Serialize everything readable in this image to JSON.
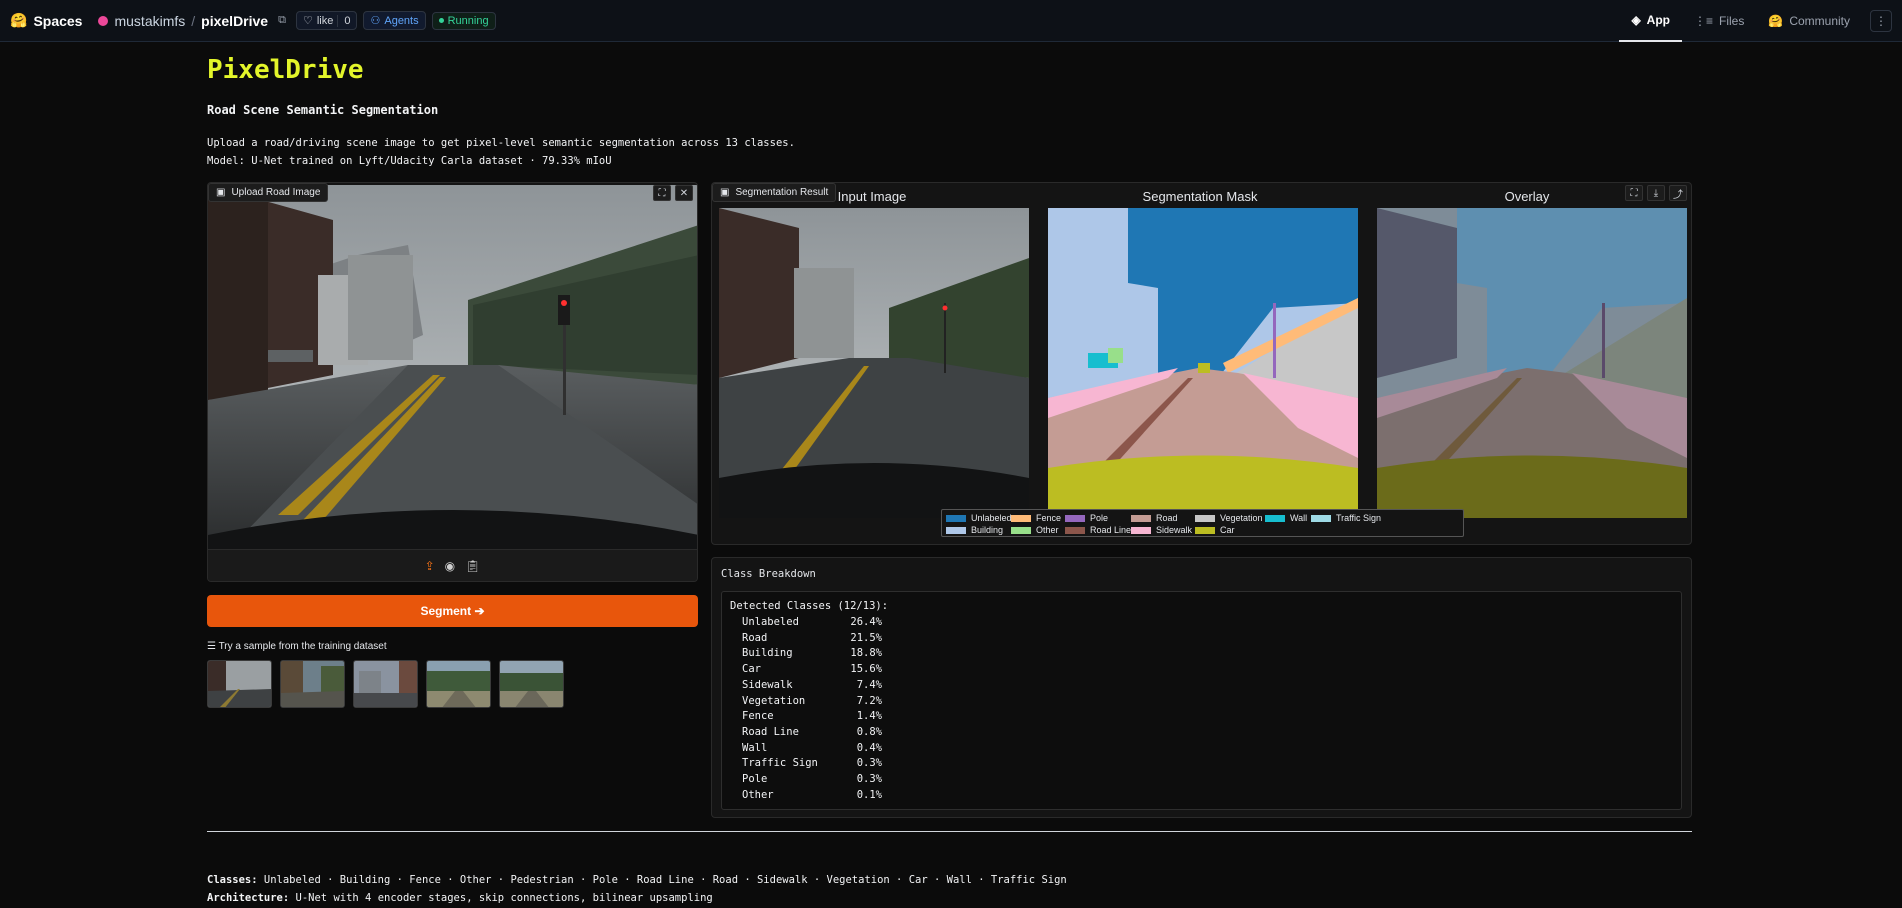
{
  "topbar": {
    "spaces_label": "Spaces",
    "owner": "mustakimfs",
    "separator": "/",
    "repo": "pixelDrive",
    "like_label": "like",
    "like_count": "0",
    "agents_label": "Agents",
    "status_label": "Running",
    "nav": [
      {
        "label": "App",
        "icon": "cube-icon",
        "active": true
      },
      {
        "label": "Files",
        "icon": "files-icon",
        "active": false
      },
      {
        "label": "Community",
        "icon": "community-icon",
        "active": false
      }
    ]
  },
  "header": {
    "title": "PixelDrive",
    "subtitle": "Road Scene Semantic Segmentation",
    "desc_line1": "Upload a road/driving scene image to get pixel-level semantic segmentation across 13 classes.",
    "desc_line2": "Model: U-Net trained on Lyft/Udacity Carla dataset · 79.33% mIoU"
  },
  "upload": {
    "label": "Upload Road Image",
    "button_label": "Segment ➔",
    "samples_label": "☰ Try a sample from the training dataset"
  },
  "result": {
    "label": "Segmentation Result",
    "col_input": "Input Image",
    "col_mask": "Segmentation Mask",
    "col_overlay": "Overlay",
    "legend": [
      {
        "name": "Unlabeled",
        "color": "#1f77b4"
      },
      {
        "name": "Building",
        "color": "#aec7e8"
      },
      {
        "name": "Fence",
        "color": "#ffbb78"
      },
      {
        "name": "Other",
        "color": "#98df8a"
      },
      {
        "name": "Pole",
        "color": "#9467bd"
      },
      {
        "name": "Road Line",
        "color": "#8c564b"
      },
      {
        "name": "Road",
        "color": "#c49c94"
      },
      {
        "name": "Sidewalk",
        "color": "#f7b6d2"
      },
      {
        "name": "Vegetation",
        "color": "#c7c7c7"
      },
      {
        "name": "Car",
        "color": "#bcbd22"
      },
      {
        "name": "Wall",
        "color": "#17becf"
      },
      {
        "name": "Traffic Sign",
        "color": "#9edae5"
      }
    ]
  },
  "breakdown": {
    "label": "Class Breakdown",
    "heading": "Detected Classes (12/13):",
    "rows": [
      {
        "name": "Unlabeled",
        "pct": "26.4%"
      },
      {
        "name": "Road",
        "pct": "21.5%"
      },
      {
        "name": "Building",
        "pct": "18.8%"
      },
      {
        "name": "Car",
        "pct": "15.6%"
      },
      {
        "name": "Sidewalk",
        "pct": "7.4%"
      },
      {
        "name": "Vegetation",
        "pct": "7.2%"
      },
      {
        "name": "Fence",
        "pct": "1.4%"
      },
      {
        "name": "Road Line",
        "pct": "0.8%"
      },
      {
        "name": "Wall",
        "pct": "0.4%"
      },
      {
        "name": "Traffic Sign",
        "pct": "0.3%"
      },
      {
        "name": "Pole",
        "pct": "0.3%"
      },
      {
        "name": "Other",
        "pct": "0.1%"
      }
    ]
  },
  "footer": {
    "classes_label": "Classes:",
    "classes_text": " Unlabeled · Building · Fence · Other · Pedestrian · Pole · Road Line · Road · Sidewalk · Vegetation · Car · Wall · Traffic Sign",
    "arch_label": "Architecture:",
    "arch_text": " U-Net with 4 encoder stages, skip connections, bilinear upsampling"
  },
  "colors": {
    "accent_title": "#e3f52a",
    "primary_button": "#e8560c",
    "running": "#34d399",
    "agents": "#60a5fa"
  }
}
